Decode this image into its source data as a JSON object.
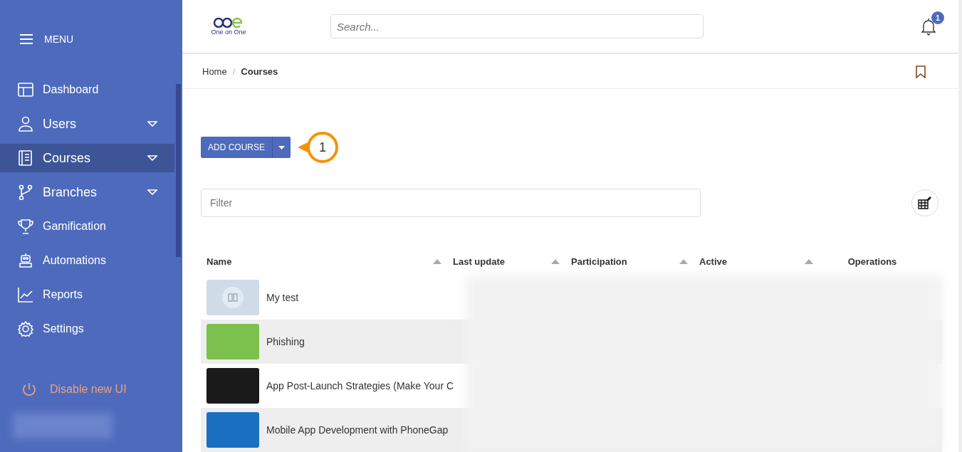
{
  "sidebar": {
    "menu_label": "MENU",
    "items": [
      {
        "label": "Dashboard",
        "selected": false,
        "has_submenu": false
      },
      {
        "label": "Users",
        "selected": false,
        "has_submenu": true
      },
      {
        "label": "Courses",
        "selected": true,
        "has_submenu": true
      },
      {
        "label": "Branches",
        "selected": false,
        "has_submenu": true
      },
      {
        "label": "Gamification",
        "selected": false,
        "has_submenu": false
      },
      {
        "label": "Automations",
        "selected": false,
        "has_submenu": false
      },
      {
        "label": "Reports",
        "selected": false,
        "has_submenu": false
      },
      {
        "label": "Settings",
        "selected": false,
        "has_submenu": false
      }
    ],
    "disable_ui": "Disable new UI"
  },
  "header": {
    "logo_text": "One on One",
    "search": {
      "placeholder": "Search..."
    },
    "notifications": "1"
  },
  "breadcrumb": {
    "items": [
      "Home",
      "Courses"
    ],
    "separator": "/"
  },
  "add_button": "ADD COURSE",
  "callout": "1",
  "filter": {
    "placeholder": "Filter"
  },
  "table": {
    "columns": [
      {
        "label": "Name",
        "sortable": true
      },
      {
        "label": "Last update",
        "sortable": true
      },
      {
        "label": "Participation",
        "sortable": true
      },
      {
        "label": "Active",
        "sortable": true
      },
      {
        "label": "Operations",
        "sortable": false
      }
    ],
    "rows": [
      {
        "name": "My test",
        "kind": "default"
      },
      {
        "name": "Phishing",
        "kind": "photo"
      },
      {
        "name": "App Post-Launch Strategies (Make Your C",
        "kind": "photo"
      },
      {
        "name": "Mobile App Development with PhoneGap",
        "kind": "photo"
      }
    ]
  }
}
